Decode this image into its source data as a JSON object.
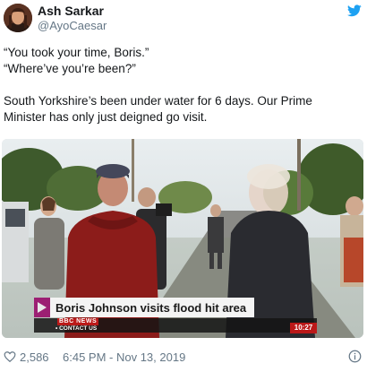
{
  "author": {
    "display_name": "Ash Sarkar",
    "handle": "@AyoCaesar",
    "avatar_icon": "profile-photo",
    "platform_icon": "twitter-bird-icon"
  },
  "body": {
    "lines": [
      "“You took your time, Boris.”",
      "“Where’ve you’re been?”",
      "",
      "South Yorkshire’s been under water for 6 days. Our Prime",
      "Minister has only just deigned go visit."
    ]
  },
  "media": {
    "headline": "Boris Johnson visits flood hit area",
    "channel_logo": "BBC NEWS",
    "ticker": "• CONTACT US",
    "clock": "10:27"
  },
  "footer": {
    "like_count": "2,586",
    "timestamp": "6:45 PM - Nov 13, 2019",
    "like_icon": "heart-icon",
    "info_icon": "info-icon"
  },
  "colors": {
    "twitter_blue": "#1da1f2",
    "text_primary": "#14171a",
    "text_secondary": "#657786",
    "bbc_red": "#bb1919",
    "headline_accent": "#9c1f73"
  }
}
